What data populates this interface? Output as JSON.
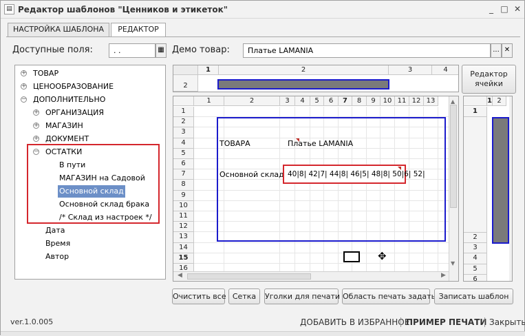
{
  "window": {
    "title": "Редактор шаблонов \"Ценников и этикеток\"",
    "minimize": "_",
    "maximize": "□",
    "close": "✕"
  },
  "tabs": [
    "НАСТРОЙКА ШАБЛОНА",
    "РЕДАКТОР"
  ],
  "fields": {
    "available_label": "Доступные поля:",
    "available_value": ". .",
    "demo_label": "Демо товар:",
    "demo_value": "Платье LAMANIA",
    "ellipsis": "...",
    "clear": "✕"
  },
  "tree": [
    {
      "label": "ТОВАР",
      "toggle": "+"
    },
    {
      "label": "ЦЕНООБРАЗОВАНИЕ",
      "toggle": "+"
    },
    {
      "label": "ДОПОЛНИТЕЛЬНО",
      "toggle": "−"
    },
    {
      "label": "ОРГАНИЗАЦИЯ",
      "toggle": "+"
    },
    {
      "label": "МАГАЗИН",
      "toggle": "+"
    },
    {
      "label": "ДОКУМЕНТ",
      "toggle": "+"
    },
    {
      "label": "ОСТАТКИ",
      "toggle": "−"
    },
    {
      "label": "В пути"
    },
    {
      "label": "МАГАЗИН на Садовой"
    },
    {
      "label": "Основной склад",
      "selected": true
    },
    {
      "label": "Основной склад брака"
    },
    {
      "label": "/* Склад из настроек */"
    },
    {
      "label": "Дата"
    },
    {
      "label": "Время"
    },
    {
      "label": "Автор"
    }
  ],
  "top_grid": {
    "cols": [
      "1",
      "2",
      "3",
      "4"
    ],
    "row": "2"
  },
  "main_grid": {
    "cols": [
      "1",
      "2",
      "3",
      "4",
      "5",
      "6",
      "7",
      "8",
      "9",
      "10",
      "11",
      "12",
      "13"
    ],
    "rows": [
      "1",
      "2",
      "3",
      "4",
      "5",
      "6",
      "7",
      "8",
      "9",
      "10",
      "11",
      "12",
      "13",
      "14",
      "15",
      "16"
    ],
    "cells": {
      "tovara": "ТОВАРА",
      "product": "Платье LAMANIA",
      "warehouse": "Основной склад",
      "sizes": "40|8| 42|7| 44|8| 46|5| 48|8| 50|6| 52|"
    }
  },
  "side_grid": {
    "cols": [
      "1",
      "2"
    ],
    "rows_top": [
      "1"
    ],
    "rows_bottom": [
      "2",
      "3",
      "4",
      "5",
      "6"
    ]
  },
  "cell_editor_button": "Редактор ячейки",
  "buttons": [
    "Очистить все",
    "Сетка",
    "Уголки для печати",
    "Область печать задать",
    "Записать шаблон"
  ],
  "footer": {
    "version": "ver.1.0.005",
    "favorites": "ДОБАВИТЬ В ИЗБРАННОЕ",
    "print_sample": "ПРИМЕР ПЕЧАТИ",
    "close": "Закрыть"
  },
  "colors": {
    "selection": "#6c8fc7",
    "highlight_red": "#d4262c",
    "frame_blue": "#1a1acc",
    "bar_gray": "#7a7a7a"
  }
}
